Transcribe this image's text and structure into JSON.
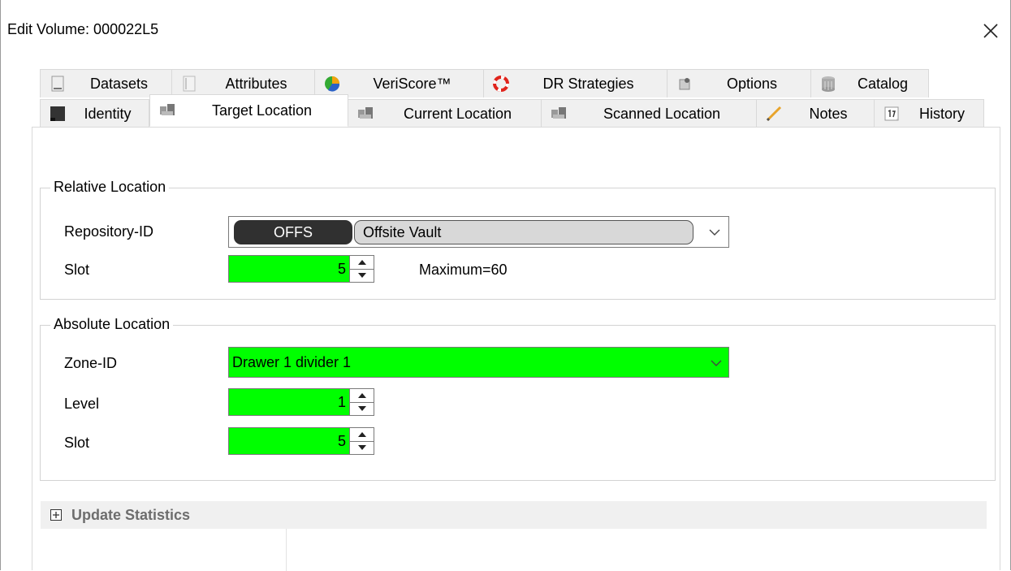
{
  "window": {
    "title": "Edit Volume: 000022L5"
  },
  "tabs": {
    "back": [
      {
        "label": "Datasets",
        "icon": "dataset-icon"
      },
      {
        "label": "Attributes",
        "icon": "attributes-icon"
      },
      {
        "label": "VeriScore™",
        "icon": "veriscore-icon"
      },
      {
        "label": "DR Strategies",
        "icon": "lifebuoy-icon"
      },
      {
        "label": "Options",
        "icon": "options-icon"
      },
      {
        "label": "Catalog",
        "icon": "database-icon"
      }
    ],
    "front": [
      {
        "label": "Identity",
        "icon": "tape-cartridge-icon"
      },
      {
        "label": "Target Location",
        "icon": "location-icon",
        "active": true
      },
      {
        "label": "Current Location",
        "icon": "location-icon"
      },
      {
        "label": "Scanned Location",
        "icon": "location-icon"
      },
      {
        "label": "Notes",
        "icon": "pencil-icon"
      },
      {
        "label": "History",
        "icon": "calendar-icon"
      }
    ]
  },
  "relative_location": {
    "title": "Relative Location",
    "repository_label": "Repository-ID",
    "repository_code": "OFFS",
    "repository_name": "Offsite Vault",
    "slot_label": "Slot",
    "slot_value": "5",
    "slot_maximum_text": "Maximum=60"
  },
  "absolute_location": {
    "title": "Absolute Location",
    "zone_label": "Zone-ID",
    "zone_value": "Drawer 1 divider 1",
    "level_label": "Level",
    "level_value": "1",
    "slot_label": "Slot",
    "slot_value": "5"
  },
  "update_statistics": {
    "label": "Update Statistics",
    "expanded": false
  },
  "colors": {
    "field_highlight": "#00ff00",
    "tab_background": "#f0f0f0",
    "repo_badge": "#303030",
    "repo_name_bg": "#d8d8d8"
  }
}
